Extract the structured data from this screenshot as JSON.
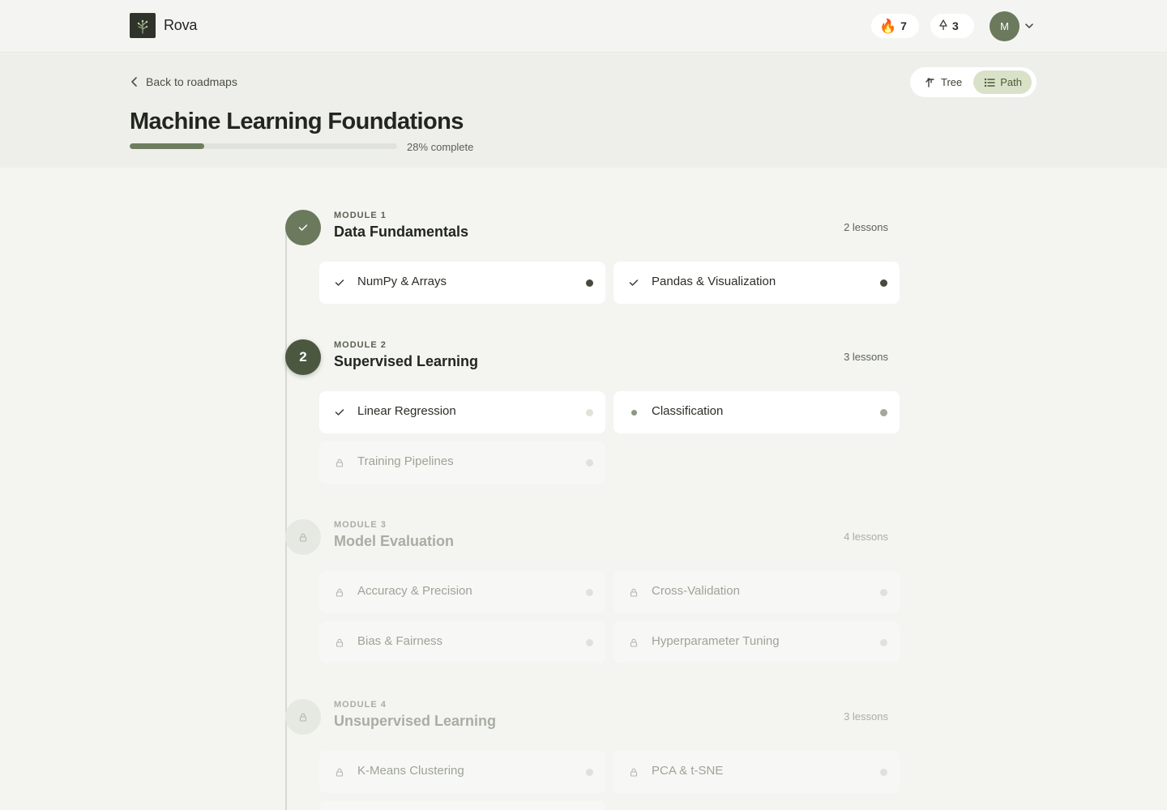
{
  "app": {
    "name": "Rova"
  },
  "header": {
    "streak": {
      "icon": "fire-icon",
      "count": "7"
    },
    "trees": {
      "icon": "tree-icon",
      "count": "3"
    },
    "user": {
      "initial": "M"
    }
  },
  "hero": {
    "back_label": "Back to roadmaps",
    "view_toggle": {
      "tree_label": "Tree",
      "path_label": "Path",
      "active": "Path"
    },
    "title": "Machine Learning Foundations",
    "progress": {
      "percent": 28,
      "label": "28% complete"
    }
  },
  "modules": [
    {
      "kicker": "MODULE 1",
      "title": "Data Fundamentals",
      "count": "2 lessons",
      "state": "done",
      "lessons": [
        {
          "name": "NumPy & Arrays",
          "state": "completed"
        },
        {
          "name": "Pandas & Visualization",
          "state": "completed"
        }
      ]
    },
    {
      "kicker": "MODULE 2",
      "title": "Supervised Learning",
      "count": "3 lessons",
      "state": "current",
      "number": "2",
      "lessons": [
        {
          "name": "Linear Regression",
          "state": "completed"
        },
        {
          "name": "Classification",
          "state": "in-progress"
        },
        {
          "name": "Training Pipelines",
          "state": "locked"
        }
      ]
    },
    {
      "kicker": "MODULE 3",
      "title": "Model Evaluation",
      "count": "4 lessons",
      "state": "locked",
      "lessons": [
        {
          "name": "Accuracy & Precision",
          "state": "locked"
        },
        {
          "name": "Cross-Validation",
          "state": "locked"
        },
        {
          "name": "Bias & Fairness",
          "state": "locked"
        },
        {
          "name": "Hyperparameter Tuning",
          "state": "locked"
        }
      ]
    },
    {
      "kicker": "MODULE 4",
      "title": "Unsupervised Learning",
      "count": "3 lessons",
      "state": "locked",
      "lessons": [
        {
          "name": "K-Means Clustering",
          "state": "locked"
        },
        {
          "name": "PCA & t-SNE",
          "state": "locked"
        }
      ]
    }
  ],
  "colors": {
    "accent": "#6b7a5d",
    "accent_dark": "#4c5740",
    "toggle_active_bg": "#d9e2c8",
    "page_bg": "#f4f5f1"
  }
}
